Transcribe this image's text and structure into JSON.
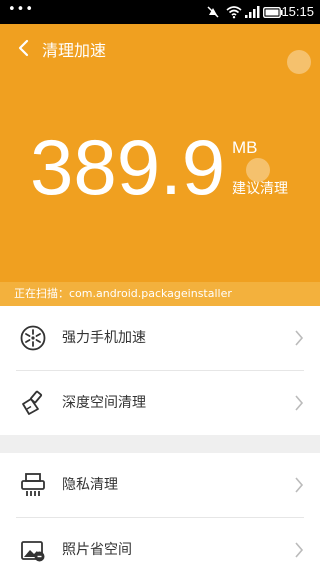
{
  "status_bar": {
    "time": "15:15"
  },
  "header": {
    "title": "清理加速",
    "amount": "389.9",
    "unit": "MB",
    "suggestion": "建议清理",
    "color": "#F0A020"
  },
  "scan": {
    "text": "正在扫描：com.android.packageinstaller"
  },
  "menu": [
    {
      "label": "强力手机加速",
      "icon": "speed-boost-icon"
    },
    {
      "label": "深度空间清理",
      "icon": "broom-icon"
    },
    {
      "label": "隐私清理",
      "icon": "shredder-icon"
    },
    {
      "label": "照片省空间",
      "icon": "photo-icon"
    }
  ]
}
